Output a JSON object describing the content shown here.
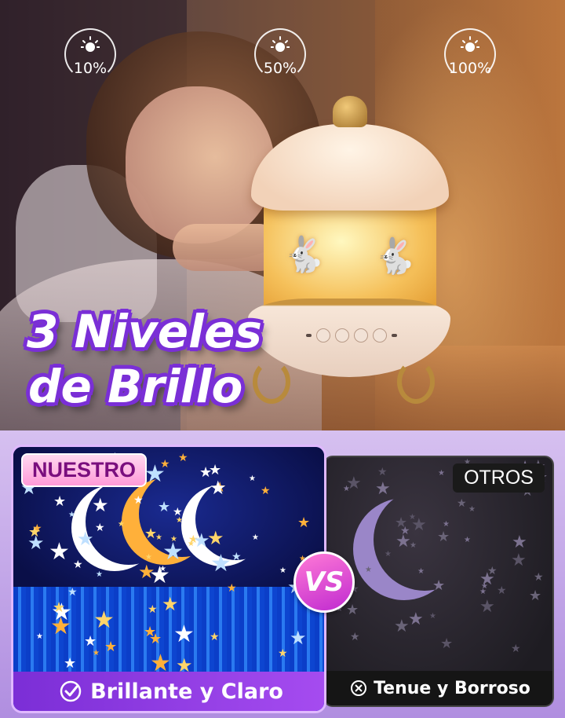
{
  "hero": {
    "brightness_levels": [
      {
        "label": "10%",
        "icon": "sun-brightness-icon"
      },
      {
        "label": "50%",
        "icon": "sun-brightness-icon"
      },
      {
        "label": "100%",
        "icon": "sun-brightness-icon"
      }
    ],
    "headline_line1": "3 Niveles",
    "headline_line2": "de Brillo",
    "colors": {
      "headline_outline": "#7a2fd6",
      "lamp_glow": "#f5c05a"
    }
  },
  "comparison": {
    "ours": {
      "label": "NUESTRO",
      "caption": "Brillante y Claro",
      "caption_icon": "check-circle-icon"
    },
    "vs": "VS",
    "others": {
      "label": "OTROS",
      "caption": "Tenue y Borroso",
      "caption_icon": "x-circle-icon"
    },
    "colors": {
      "accent": "#a64cf0",
      "vs_badge": "#e04ad6"
    }
  }
}
